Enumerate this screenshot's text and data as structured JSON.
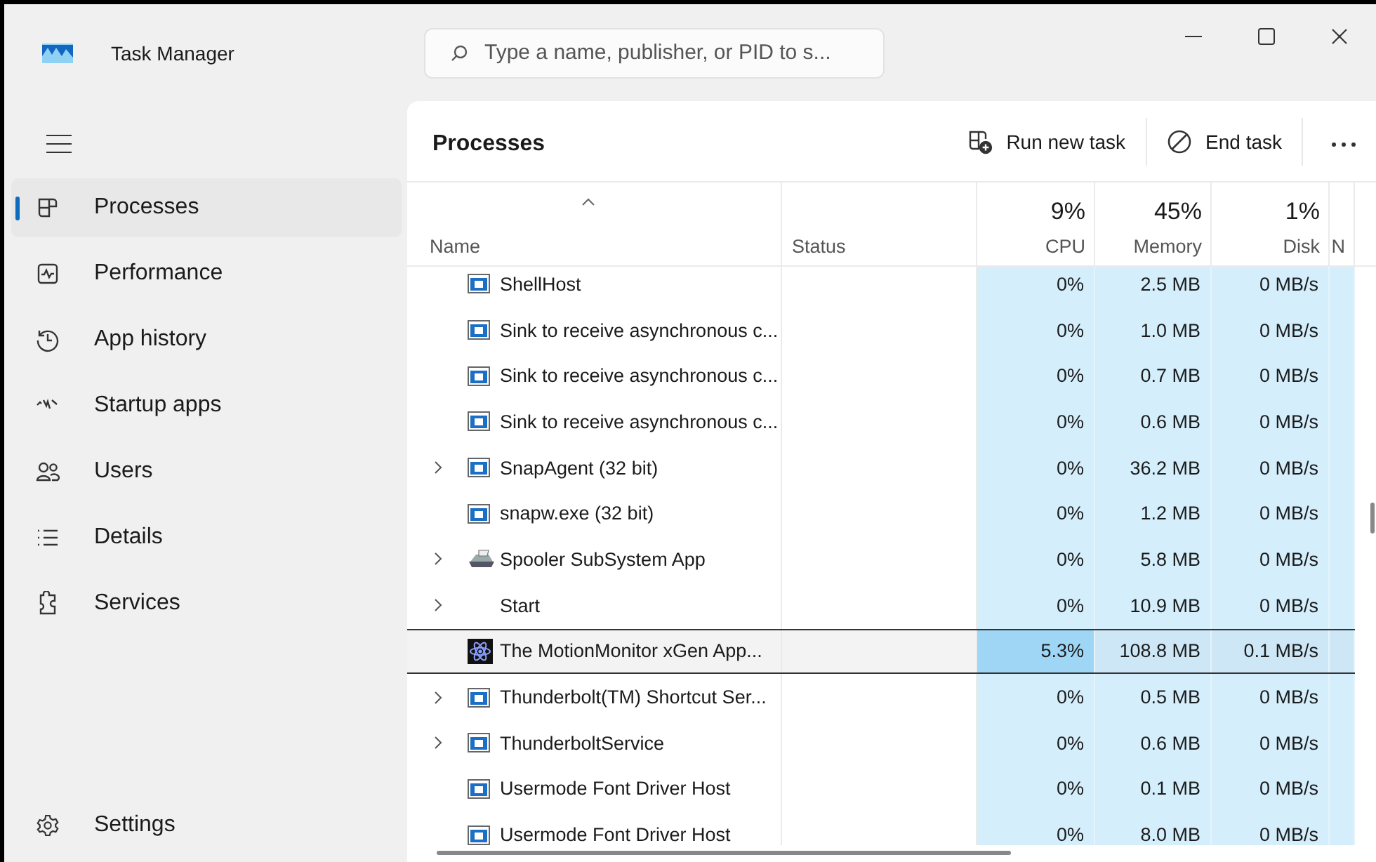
{
  "window": {
    "title": "Task Manager"
  },
  "search": {
    "placeholder": "Type a name, publisher, or PID to s..."
  },
  "sidebar": {
    "items": [
      {
        "label": "Processes",
        "selected": true
      },
      {
        "label": "Performance",
        "selected": false
      },
      {
        "label": "App history",
        "selected": false
      },
      {
        "label": "Startup apps",
        "selected": false
      },
      {
        "label": "Users",
        "selected": false
      },
      {
        "label": "Details",
        "selected": false
      },
      {
        "label": "Services",
        "selected": false
      }
    ],
    "footer": {
      "label": "Settings"
    }
  },
  "toolbar": {
    "title": "Processes",
    "buttons": [
      {
        "label": "Run new task"
      },
      {
        "label": "End task"
      }
    ]
  },
  "table": {
    "columns": [
      {
        "label": "Name",
        "sorted": true
      },
      {
        "label": "Status"
      },
      {
        "label": "CPU",
        "total": "9%"
      },
      {
        "label": "Memory",
        "total": "45%"
      },
      {
        "label": "Disk",
        "total": "1%"
      },
      {
        "label": "N"
      }
    ],
    "rows": [
      {
        "name": "ShellHost",
        "kind": "app",
        "expandable": false,
        "selected": false,
        "cpu_busy": false,
        "cpu": "0%",
        "memory": "2.5 MB",
        "disk": "0 MB/s"
      },
      {
        "name": "Sink to receive asynchronous c...",
        "kind": "app",
        "expandable": false,
        "selected": false,
        "cpu_busy": false,
        "cpu": "0%",
        "memory": "1.0 MB",
        "disk": "0 MB/s"
      },
      {
        "name": "Sink to receive asynchronous c...",
        "kind": "app",
        "expandable": false,
        "selected": false,
        "cpu_busy": false,
        "cpu": "0%",
        "memory": "0.7 MB",
        "disk": "0 MB/s"
      },
      {
        "name": "Sink to receive asynchronous c...",
        "kind": "app",
        "expandable": false,
        "selected": false,
        "cpu_busy": false,
        "cpu": "0%",
        "memory": "0.6 MB",
        "disk": "0 MB/s"
      },
      {
        "name": "SnapAgent (32 bit)",
        "kind": "app",
        "expandable": true,
        "selected": false,
        "cpu_busy": false,
        "cpu": "0%",
        "memory": "36.2 MB",
        "disk": "0 MB/s"
      },
      {
        "name": "snapw.exe (32 bit)",
        "kind": "app",
        "expandable": false,
        "selected": false,
        "cpu_busy": false,
        "cpu": "0%",
        "memory": "1.2 MB",
        "disk": "0 MB/s"
      },
      {
        "name": "Spooler SubSystem App",
        "kind": "printer",
        "expandable": true,
        "selected": false,
        "cpu_busy": false,
        "cpu": "0%",
        "memory": "5.8 MB",
        "disk": "0 MB/s"
      },
      {
        "name": "Start",
        "kind": "plain",
        "expandable": true,
        "selected": false,
        "cpu_busy": false,
        "cpu": "0%",
        "memory": "10.9 MB",
        "disk": "0 MB/s"
      },
      {
        "name": "The MotionMonitor xGen App...",
        "kind": "atom",
        "expandable": false,
        "selected": true,
        "cpu_busy": true,
        "cpu": "5.3%",
        "memory": "108.8 MB",
        "disk": "0.1 MB/s"
      },
      {
        "name": "Thunderbolt(TM) Shortcut Ser...",
        "kind": "app",
        "expandable": true,
        "selected": false,
        "cpu_busy": false,
        "cpu": "0%",
        "memory": "0.5 MB",
        "disk": "0 MB/s"
      },
      {
        "name": "ThunderboltService",
        "kind": "app",
        "expandable": true,
        "selected": false,
        "cpu_busy": false,
        "cpu": "0%",
        "memory": "0.6 MB",
        "disk": "0 MB/s"
      },
      {
        "name": "Usermode Font Driver Host",
        "kind": "app",
        "expandable": false,
        "selected": false,
        "cpu_busy": false,
        "cpu": "0%",
        "memory": "0.1 MB",
        "disk": "0 MB/s"
      },
      {
        "name": "Usermode Font Driver Host",
        "kind": "app",
        "expandable": false,
        "selected": false,
        "cpu_busy": false,
        "cpu": "0%",
        "memory": "8.0 MB",
        "disk": "0 MB/s"
      }
    ]
  }
}
